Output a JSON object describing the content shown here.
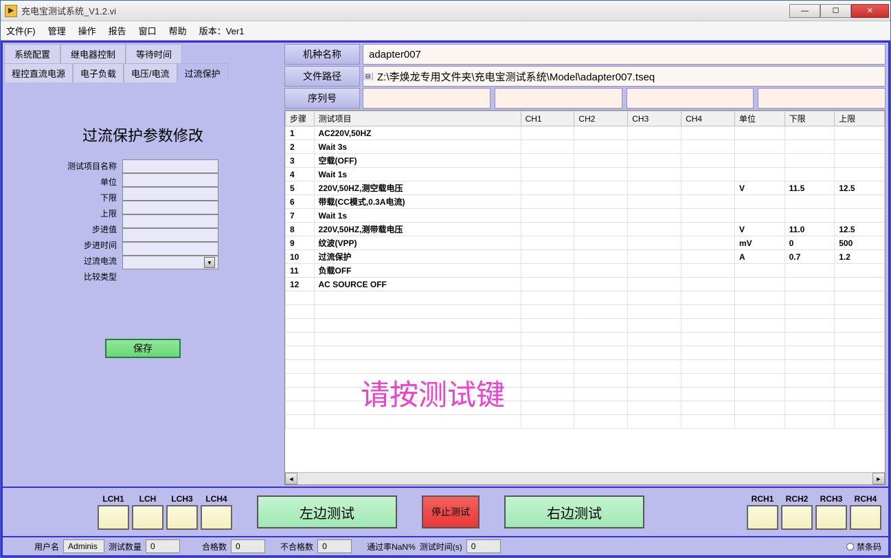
{
  "window": {
    "title": "充电宝测试系统_V1.2.vi"
  },
  "menu": [
    "文件(F)",
    "管理",
    "操作",
    "报告",
    "窗口",
    "帮助",
    "版本：Ver1"
  ],
  "left": {
    "tabs_row1": [
      "系统配置",
      "继电器控制",
      "等待时间"
    ],
    "tabs_row2": [
      "程控直流电源",
      "电子负载",
      "电压/电流",
      "过流保护"
    ],
    "selected_tab": "过流保护",
    "title": "过流保护参数修改",
    "params": [
      "测试项目名称",
      "单位",
      "下限",
      "上限",
      "步进值",
      "步进时间",
      "过流电流",
      "比较类型"
    ],
    "save": "保存"
  },
  "info": {
    "model_label": "机种名称",
    "model_value": "adapter007",
    "path_label": "文件路径",
    "path_value": "Z:\\李焕龙专用文件夹\\充电宝测试系统\\Model\\adapter007.tseq",
    "serial_label": "序列号"
  },
  "grid": {
    "headers": [
      "步骤",
      "测试项目",
      "CH1",
      "CH2",
      "CH3",
      "CH4",
      "单位",
      "下限",
      "上限"
    ],
    "rows": [
      {
        "step": "1",
        "item": "AC220V,50HZ",
        "ch1": "",
        "ch2": "",
        "ch3": "",
        "ch4": "",
        "unit": "",
        "lo": "",
        "hi": ""
      },
      {
        "step": "2",
        "item": "Wait 3s",
        "ch1": "",
        "ch2": "",
        "ch3": "",
        "ch4": "",
        "unit": "",
        "lo": "",
        "hi": ""
      },
      {
        "step": "3",
        "item": "空载(OFF)",
        "ch1": "",
        "ch2": "",
        "ch3": "",
        "ch4": "",
        "unit": "",
        "lo": "",
        "hi": ""
      },
      {
        "step": "4",
        "item": "Wait  1s",
        "ch1": "",
        "ch2": "",
        "ch3": "",
        "ch4": "",
        "unit": "",
        "lo": "",
        "hi": ""
      },
      {
        "step": "5",
        "item": "220V,50HZ,测空载电压",
        "ch1": "",
        "ch2": "",
        "ch3": "",
        "ch4": "",
        "unit": "V",
        "lo": "11.5",
        "hi": "12.5"
      },
      {
        "step": "6",
        "item": "带载(CC模式,0.3A电流)",
        "ch1": "",
        "ch2": "",
        "ch3": "",
        "ch4": "",
        "unit": "",
        "lo": "",
        "hi": ""
      },
      {
        "step": "7",
        "item": "Wait 1s",
        "ch1": "",
        "ch2": "",
        "ch3": "",
        "ch4": "",
        "unit": "",
        "lo": "",
        "hi": ""
      },
      {
        "step": "8",
        "item": "220V,50HZ,测带载电压",
        "ch1": "",
        "ch2": "",
        "ch3": "",
        "ch4": "",
        "unit": "V",
        "lo": "11.0",
        "hi": "12.5"
      },
      {
        "step": "9",
        "item": "纹波(VPP)",
        "ch1": "",
        "ch2": "",
        "ch3": "",
        "ch4": "",
        "unit": "mV",
        "lo": "0",
        "hi": "500"
      },
      {
        "step": "10",
        "item": "过流保护",
        "ch1": "",
        "ch2": "",
        "ch3": "",
        "ch4": "",
        "unit": "A",
        "lo": "0.7",
        "hi": "1.2"
      },
      {
        "step": "11",
        "item": "负载OFF",
        "ch1": "",
        "ch2": "",
        "ch3": "",
        "ch4": "",
        "unit": "",
        "lo": "",
        "hi": ""
      },
      {
        "step": "12",
        "item": "AC SOURCE OFF",
        "ch1": "",
        "ch2": "",
        "ch3": "",
        "ch4": "",
        "unit": "",
        "lo": "",
        "hi": ""
      }
    ],
    "overlay": "请按测试键"
  },
  "lower": {
    "left_inds": [
      "LCH1",
      "LCH",
      "LCH3",
      "LCH4"
    ],
    "right_inds": [
      "RCH1",
      "RCH2",
      "RCH3",
      "RCH4"
    ],
    "btn_left": "左边测试",
    "btn_stop": "停止测试",
    "btn_right": "右边测试"
  },
  "status": {
    "user_label": "用户名",
    "user_value": "Adminis",
    "count_label": "测试数量",
    "count_value": "0",
    "pass_label": "合格数",
    "pass_value": "0",
    "fail_label": "不合格数",
    "fail_value": "0",
    "rate_label": "通过率NaN%",
    "time_label": "测试时间(s)",
    "time_value": "0",
    "barcode_label": "禁条码"
  }
}
